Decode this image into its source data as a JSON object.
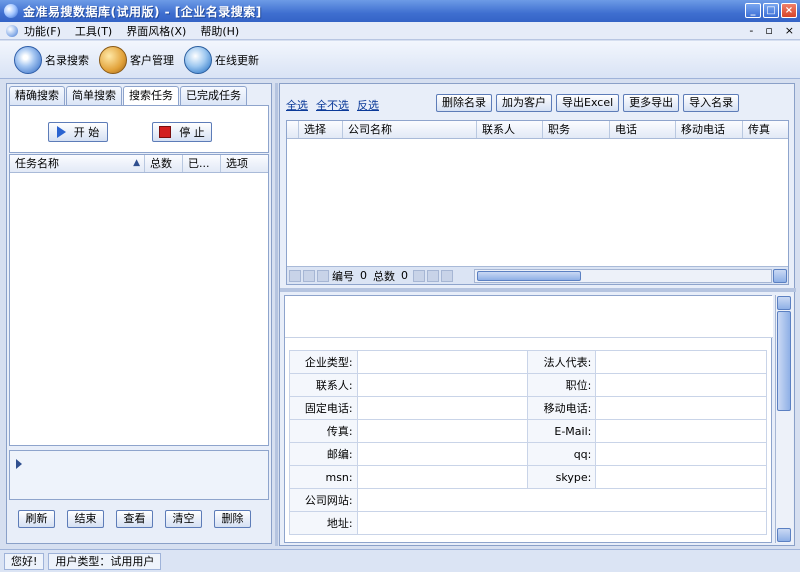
{
  "window": {
    "title": "金准易搜数据库(试用版) - [企业名录搜索]",
    "min": "_",
    "max": "□",
    "close": "×"
  },
  "menu": {
    "items": [
      "功能(F)",
      "工具(T)",
      "界面风格(X)",
      "帮助(H)"
    ],
    "mdi": [
      "-",
      "▫",
      "×"
    ]
  },
  "toolbar": {
    "search_label": "名录搜索",
    "client_label": "客户管理",
    "update_label": "在线更新"
  },
  "left": {
    "tabs": [
      "精确搜索",
      "简单搜索",
      "搜索任务",
      "已完成任务"
    ],
    "start_label": "开 始",
    "stop_label": "停 止",
    "list_cols": [
      "任务名称",
      "总数",
      "已...",
      "选项"
    ],
    "sort_arrow": "▲",
    "buttons": [
      "刷新",
      "结束",
      "查看",
      "清空",
      "删除"
    ]
  },
  "right": {
    "links": [
      "全选",
      "全不选",
      "反选"
    ],
    "actions": [
      "删除名录",
      "加为客户",
      "导出Excel",
      "更多导出",
      "导入名录"
    ],
    "grid_cols": [
      "选择",
      "公司名称",
      "联系人",
      "职务",
      "电话",
      "移动电话",
      "传真"
    ],
    "rec_label": "编号",
    "rec_value": "0",
    "total_label": "总数",
    "total_value": "0",
    "form": [
      [
        "企业类型:",
        "",
        "法人代表:",
        ""
      ],
      [
        "联系人:",
        "",
        "职位:",
        ""
      ],
      [
        "固定电话:",
        "",
        "移动电话:",
        ""
      ],
      [
        "传真:",
        "",
        "E-Mail:",
        ""
      ],
      [
        "邮编:",
        "",
        "qq:",
        ""
      ],
      [
        "msn:",
        "",
        "skype:",
        ""
      ],
      [
        "公司网站:",
        ""
      ],
      [
        "地址:",
        ""
      ]
    ]
  },
  "status": {
    "hello": "您好!",
    "user_type": "用户类型：试用用户"
  }
}
